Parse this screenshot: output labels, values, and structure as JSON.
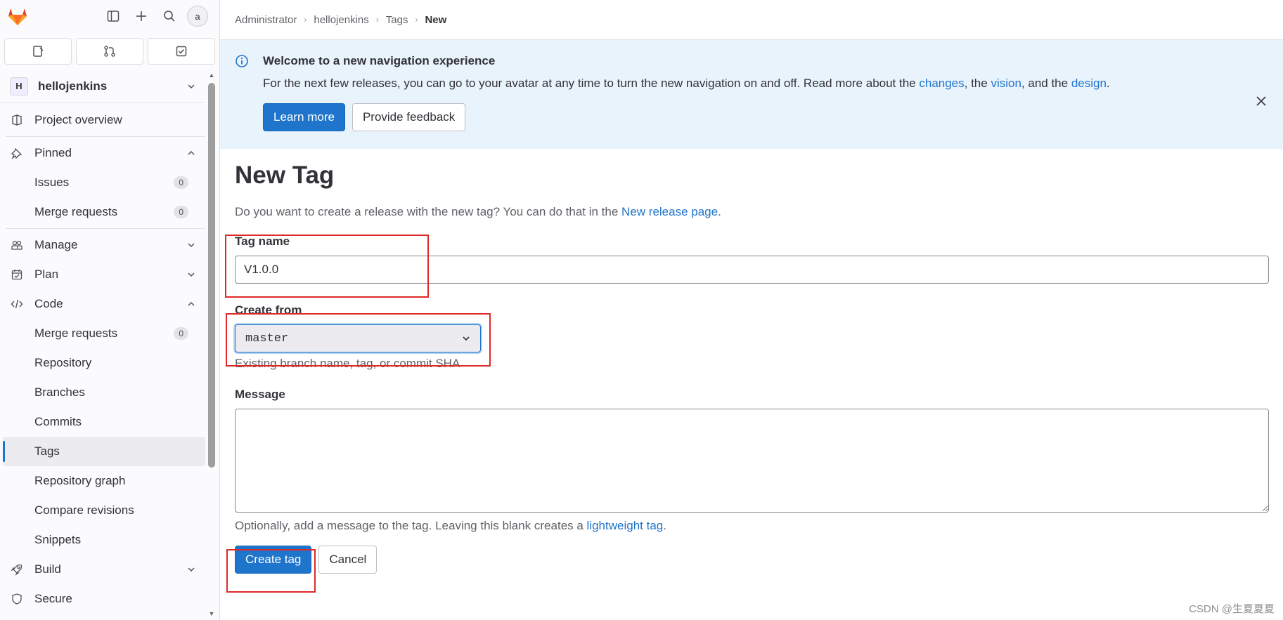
{
  "sidebar": {
    "project_initial": "H",
    "project_name": "hellojenkins",
    "avatar_text": "a",
    "items": [
      {
        "label": "Project overview"
      },
      {
        "label": "Pinned"
      },
      {
        "label": "Issues",
        "badge": "0"
      },
      {
        "label": "Merge requests",
        "badge": "0"
      },
      {
        "label": "Manage"
      },
      {
        "label": "Plan"
      },
      {
        "label": "Code"
      },
      {
        "label": "Merge requests",
        "badge": "0"
      },
      {
        "label": "Repository"
      },
      {
        "label": "Branches"
      },
      {
        "label": "Commits"
      },
      {
        "label": "Tags"
      },
      {
        "label": "Repository graph"
      },
      {
        "label": "Compare revisions"
      },
      {
        "label": "Snippets"
      },
      {
        "label": "Build"
      },
      {
        "label": "Secure"
      }
    ]
  },
  "breadcrumb": [
    "Administrator",
    "hellojenkins",
    "Tags",
    "New"
  ],
  "banner": {
    "title": "Welcome to a new navigation experience",
    "text_before": "For the next few releases, you can go to your avatar at any time to turn the new navigation on and off. Read more about the ",
    "link_changes": "changes",
    "text_mid1": ", the ",
    "link_vision": "vision",
    "text_mid2": ", and the ",
    "link_design": "design",
    "text_end": ".",
    "learn_more": "Learn more",
    "feedback": "Provide feedback"
  },
  "form": {
    "title": "New Tag",
    "intro_text": "Do you want to create a release with the new tag? You can do that in the ",
    "intro_link": "New release page",
    "intro_end": ".",
    "tag_name_label": "Tag name",
    "tag_name_value": "V1.0.0",
    "create_from_label": "Create from",
    "create_from_value": "master",
    "create_from_help": "Existing branch name, tag, or commit SHA",
    "message_label": "Message",
    "message_help_text": "Optionally, add a message to the tag. Leaving this blank creates a ",
    "message_help_link": "lightweight tag",
    "message_help_end": ".",
    "create_button": "Create tag",
    "cancel_button": "Cancel"
  },
  "watermark": "CSDN @生夏夏夏",
  "colors": {
    "accent": "#1f75cb",
    "highlight_box": "#e02828",
    "banner_bg": "#e9f3fc"
  }
}
